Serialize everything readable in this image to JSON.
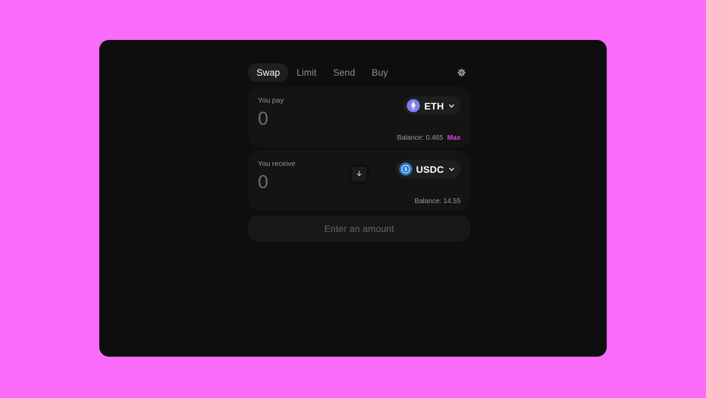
{
  "theme": {
    "page_background": "#fa6bfa",
    "panel_background": "#0e0e0e",
    "card_background": "#141414",
    "accent_max": "#e040e0",
    "eth_logo_color": "#7b7ff0",
    "usdc_logo_color": "#2775ca"
  },
  "tabs": [
    {
      "label": "Swap",
      "active": true
    },
    {
      "label": "Limit",
      "active": false
    },
    {
      "label": "Send",
      "active": false
    },
    {
      "label": "Buy",
      "active": false
    }
  ],
  "settings": {
    "icon": "gear-icon"
  },
  "swap_direction": {
    "icon": "arrow-down-icon"
  },
  "pay": {
    "label": "You pay",
    "amount": "0",
    "placeholder": "0",
    "token": {
      "symbol": "ETH",
      "logo": "ethereum-icon",
      "chevron": "chevron-down-icon"
    },
    "balance": "Balance: 0.465",
    "max_label": "Max"
  },
  "receive": {
    "label": "You receive",
    "amount": "0",
    "placeholder": "0",
    "token": {
      "symbol": "USDC",
      "logo": "usd-coin-icon",
      "chevron": "chevron-down-icon"
    },
    "balance": "Balance: 14.55"
  },
  "submit": {
    "label": "Enter an amount"
  }
}
